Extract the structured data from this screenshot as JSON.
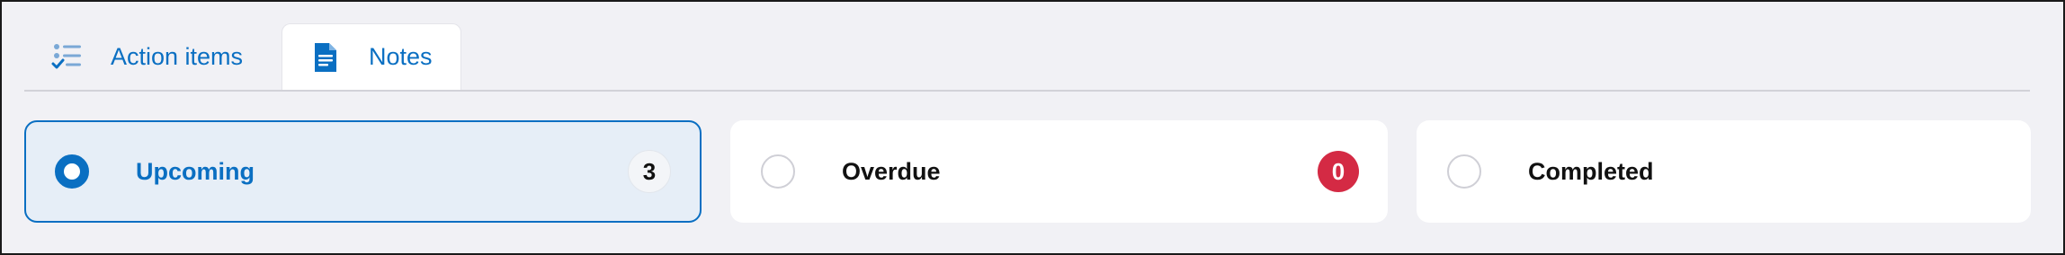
{
  "tabs": {
    "action_items": {
      "label": "Action items",
      "icon": "checklist-icon",
      "active": false
    },
    "notes": {
      "label": "Notes",
      "icon": "document-icon",
      "active": true
    }
  },
  "filters": {
    "upcoming": {
      "label": "Upcoming",
      "count": "3",
      "selected": true
    },
    "overdue": {
      "label": "Overdue",
      "count": "0",
      "selected": false
    },
    "completed": {
      "label": "Completed",
      "selected": false
    }
  },
  "colors": {
    "accent": "#0a6fc2",
    "danger": "#d42a44",
    "background": "#f1f1f5",
    "card": "#ffffff",
    "selected_card": "#e6eef7"
  }
}
